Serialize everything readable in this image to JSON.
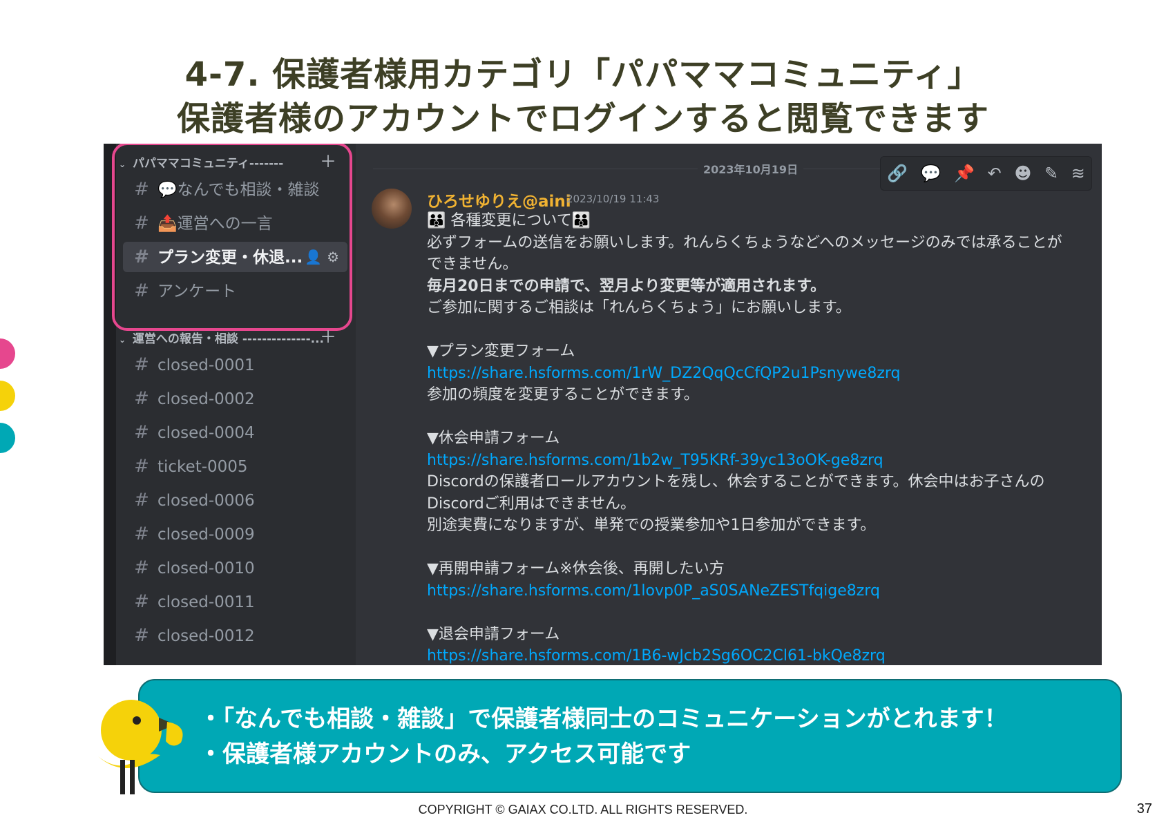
{
  "slide": {
    "title_line1": "4-7. 保護者様用カテゴリ「パパママコミュニティ」",
    "title_line2": "保護者様のアカウントでログインすると閲覧できます",
    "accent_colors": [
      "#e6478e",
      "#f5d20a",
      "#00a8b5"
    ],
    "copyright": "COPYRIGHT © GAIAX CO.LTD. ALL RIGHTS RESERVED.",
    "page_number": "37"
  },
  "sidebar": {
    "category1": {
      "label": "パパママコミュニティ-------",
      "collapsed_icon": "chevron-down-icon",
      "add_icon": "plus-icon"
    },
    "category1_channels": [
      {
        "label": "💬なんでも相談・雑談"
      },
      {
        "label": "📤運営への一言"
      },
      {
        "label": "プラン変更・休退...",
        "active": true
      },
      {
        "label": "アンケート"
      }
    ],
    "category2": {
      "label": "運営への報告・相談 --------------..."
    },
    "category2_channels": [
      {
        "label": "closed-0001"
      },
      {
        "label": "closed-0002"
      },
      {
        "label": "closed-0004"
      },
      {
        "label": "ticket-0005"
      },
      {
        "label": "closed-0006"
      },
      {
        "label": "closed-0009"
      },
      {
        "label": "closed-0010"
      },
      {
        "label": "closed-0011"
      },
      {
        "label": "closed-0012"
      }
    ]
  },
  "chat": {
    "date_divider": "2023年10月19日",
    "toolbar_icons": [
      "link-icon",
      "thread-icon",
      "pin-icon",
      "reply-icon",
      "emoji-icon",
      "edit-icon",
      "more-icon"
    ],
    "message": {
      "author": "ひろせゆりえ@aini",
      "timestamp": "2023/10/19 11:43",
      "lines": [
        "👪 各種変更について👪",
        "必ずフォームの送信をお願いします。れんらくちょうなどへのメッセージのみでは承ることが",
        "できません。",
        "毎月20日までの申請で、翌月より変更等が適用されます。",
        "ご参加に関するご相談は「れんらくちょう」にお願いします。",
        "▼プラン変更フォーム",
        "https://share.hsforms.com/1rW_DZ2QqQcCfQP2u1Psnywe8zrq",
        "参加の頻度を変更することができます。",
        "▼休会申請フォーム",
        "https://share.hsforms.com/1b2w_T95KRf-39yc13oOK-ge8zrq",
        "Discordの保護者ロールアカウントを残し、休会することができます。休会中はお子さんの",
        "Discordご利用はできません。",
        "別途実費になりますが、単発での授業参加や1日参加ができます。",
        "▼再開申請フォーム※休会後、再開したい方",
        "https://share.hsforms.com/1lovp0P_aS0SANeZESTfqige8zrq",
        "▼退会申請フォーム",
        "https://share.hsforms.com/1B6-wJcb2Sg6OC2Cl61-bkQe8zrq"
      ]
    }
  },
  "banner": {
    "line1": "・「なんでも相談・雑談」で保護者様同士のコミュニケーションがとれます！",
    "line2": "・保護者様アカウントのみ、アクセス可能です"
  }
}
